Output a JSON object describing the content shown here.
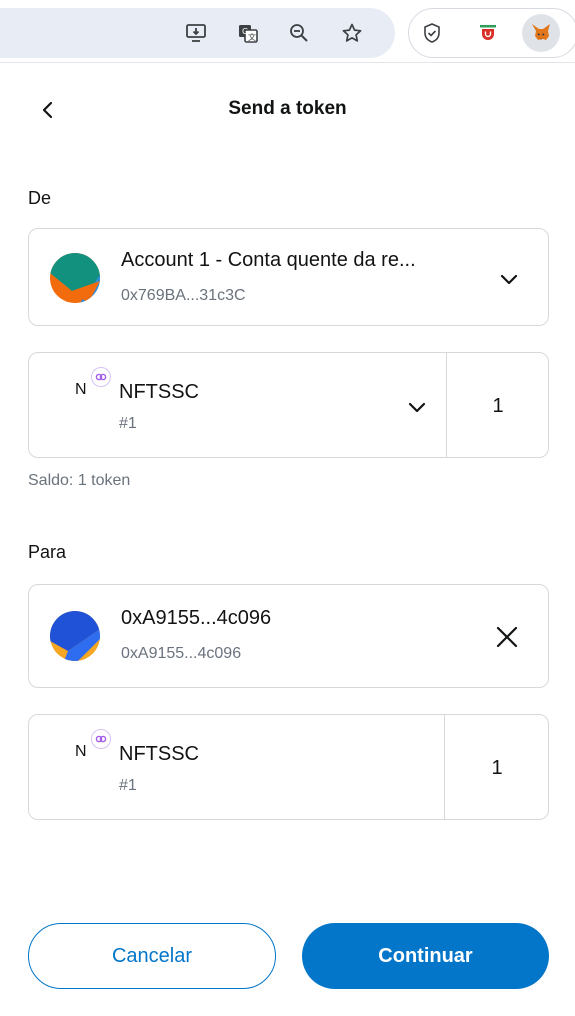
{
  "header": {
    "title": "Send a token"
  },
  "from": {
    "label": "De",
    "account_name": "Account 1 - Conta quente da re...",
    "account_address": "0x769BA...31c3C",
    "asset": {
      "letter": "N",
      "name": "NFTSSC",
      "token_id": "#1",
      "amount": "1"
    },
    "balance": "Saldo: 1 token"
  },
  "to": {
    "label": "Para",
    "recipient_name": "0xA9155...4c096",
    "recipient_address": "0xA9155...4c096",
    "asset": {
      "letter": "N",
      "name": "NFTSSC",
      "token_id": "#1",
      "amount": "1"
    }
  },
  "footer": {
    "cancel_label": "Cancelar",
    "continue_label": "Continuar"
  },
  "colors": {
    "accent": "#0376c9",
    "border": "#d6d9dc",
    "muted_text": "#6a737d"
  },
  "icons": {
    "toolbar": [
      "install-app-icon",
      "translate-icon",
      "zoom-icon",
      "bookmark-star-icon",
      "shield-extension-icon",
      "red-extension-icon",
      "metamask-fox-icon"
    ],
    "ui": [
      "back-arrow-icon",
      "chevron-down-icon",
      "close-icon",
      "nft-link-icon"
    ]
  }
}
